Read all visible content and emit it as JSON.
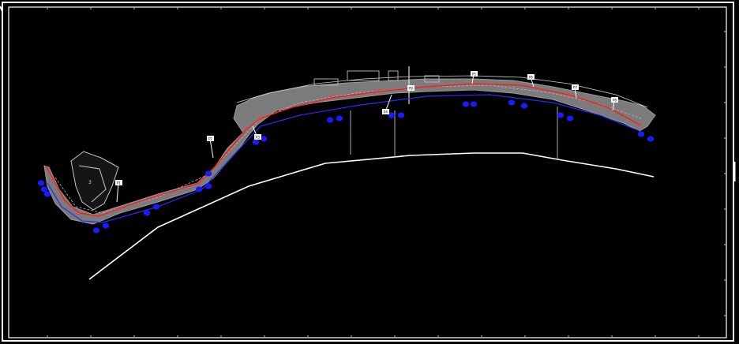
{
  "drawing": {
    "background": "#000000",
    "frame_color": "#ffffff",
    "corridor_color": "#8a8a8a",
    "centerline_color": "#ff1a1a",
    "marker_color": "#1a1aff",
    "edge_line_color": "#2a2aff",
    "label_color": "#ffffff"
  },
  "map_labels": [
    "3"
  ],
  "callout_tags": [
    "P1",
    "P2",
    "P3",
    "P4",
    "P5",
    "P6",
    "P7",
    "P8",
    "P9"
  ]
}
